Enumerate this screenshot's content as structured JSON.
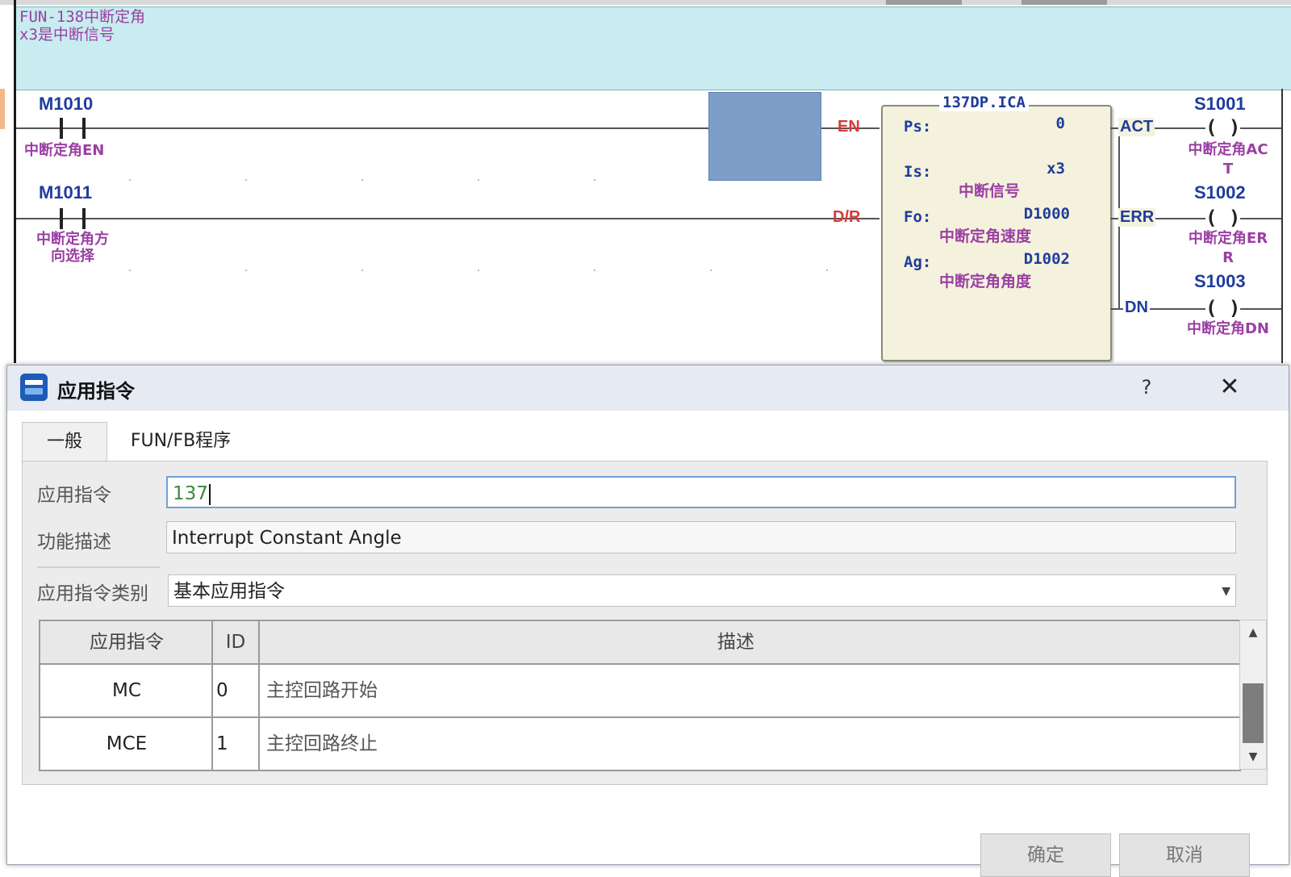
{
  "ladder": {
    "comment_lines": [
      "FUN-138中断定角",
      "x3是中断信号"
    ],
    "rung1": {
      "contact_addr": "M1010",
      "contact_comment": "中断定角EN"
    },
    "rung2": {
      "contact_addr": "M1011",
      "contact_comment_lines": [
        "中断定角方",
        "向选择"
      ]
    },
    "function_block": {
      "title": "137DP.ICA",
      "inputs": [
        "EN",
        "D/R"
      ],
      "outputs": [
        "ACT",
        "ERR",
        "DN"
      ],
      "params": [
        {
          "label": "Ps:",
          "value": "0",
          "comment": ""
        },
        {
          "label": "Is:",
          "value": "x3",
          "comment": "中断信号"
        },
        {
          "label": "Fo:",
          "value": "D1000",
          "comment": "中断定角速度"
        },
        {
          "label": "Ag:",
          "value": "D1002",
          "comment": "中断定角角度"
        }
      ]
    },
    "coils": [
      {
        "addr": "S1001",
        "symbol": "( )",
        "comment_lines": [
          "中断定角AC",
          "T"
        ]
      },
      {
        "addr": "S1002",
        "symbol": "( )",
        "comment_lines": [
          "中断定角ER",
          "R"
        ]
      },
      {
        "addr": "S1003",
        "symbol": "( )",
        "comment_lines": [
          "中断定角DN"
        ]
      }
    ]
  },
  "dialog": {
    "title": "应用指令",
    "help_symbol": "?",
    "close_symbol": "✕",
    "tabs": [
      "一般",
      "FUN/FB程序"
    ],
    "fields": {
      "instruction_label": "应用指令",
      "instruction_value": "137",
      "description_label": "功能描述",
      "description_value": "Interrupt Constant Angle",
      "category_label": "应用指令类别",
      "category_value": "基本应用指令"
    },
    "table": {
      "columns": [
        "应用指令",
        "ID",
        "描述"
      ],
      "rows": [
        {
          "instruction": "MC",
          "id": "0",
          "description": "主控回路开始"
        },
        {
          "instruction": "MCE",
          "id": "1",
          "description": "主控回路终止"
        }
      ]
    },
    "buttons": {
      "ok": "确定",
      "cancel": "取消"
    }
  }
}
